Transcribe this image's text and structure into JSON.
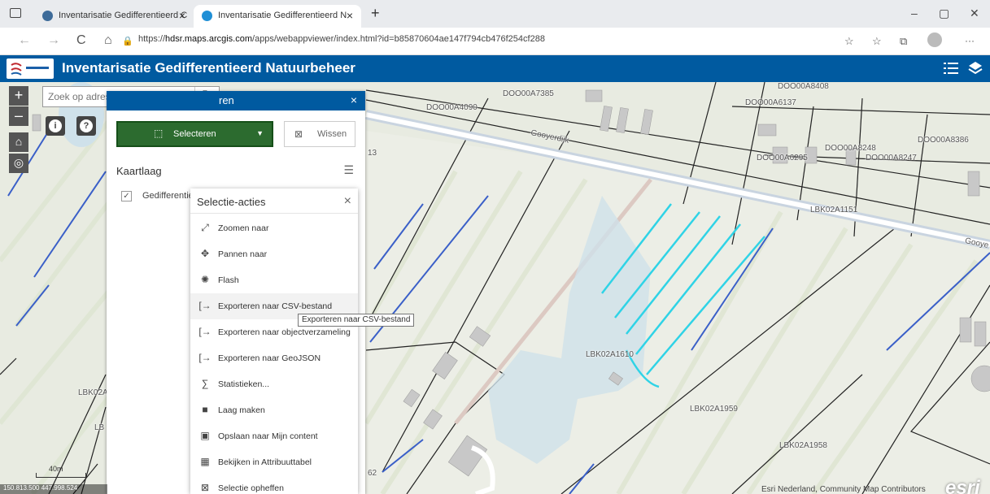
{
  "browser": {
    "tabs": [
      {
        "title": "Inventarisatie Gedifferentieerd C"
      },
      {
        "title": "Inventarisatie Gedifferentieerd N"
      }
    ],
    "new_tab": "+",
    "url_prefix": "https://",
    "url_host": "hdsr.maps.arcgis.com",
    "url_path": "/apps/webappviewer/index.html?id=b85870604ae147f794cb476f254cf288",
    "controls": {
      "back": "←",
      "forward": "→",
      "refresh": "C",
      "home": "⌂",
      "minimize": "–",
      "maximize": "▢",
      "close": "✕",
      "more": "···"
    }
  },
  "app": {
    "title": "Inventarisatie Gedifferentieerd Natuurbeheer",
    "accent_color": "#005aa0"
  },
  "map_controls": {
    "zoom_in": "+",
    "zoom_out": "–",
    "search_placeholder": "Zoek op adres",
    "info": "i",
    "help": "?"
  },
  "select_panel": {
    "title": "ren",
    "close": "×",
    "select_button": "Selecteren",
    "clear_button": "Wissen",
    "layer_header": "Kaartlaag",
    "layer_name": "Gedifferentieerd",
    "layer_checked": true
  },
  "actions": {
    "title": "Selectie-acties",
    "close": "×",
    "items": [
      {
        "label": "Zoomen naar",
        "icon": "zoom-to-icon",
        "glyph": "⤢"
      },
      {
        "label": "Pannen naar",
        "icon": "pan-to-icon",
        "glyph": "✥"
      },
      {
        "label": "Flash",
        "icon": "flash-icon",
        "glyph": "✺"
      },
      {
        "label": "Exporteren naar CSV-bestand",
        "icon": "export-icon",
        "glyph": "[→"
      },
      {
        "label": "Exporteren naar objectverzameling",
        "icon": "export-icon",
        "glyph": "[→"
      },
      {
        "label": "Exporteren naar GeoJSON",
        "icon": "export-icon",
        "glyph": "[→"
      },
      {
        "label": "Statistieken...",
        "icon": "sigma-icon",
        "glyph": "∑"
      },
      {
        "label": "Laag maken",
        "icon": "layer-create-icon",
        "glyph": "■"
      },
      {
        "label": "Opslaan naar Mijn content",
        "icon": "save-icon",
        "glyph": "▣"
      },
      {
        "label": "Bekijken in Attribuuttabel",
        "icon": "table-icon",
        "glyph": "▦"
      },
      {
        "label": "Selectie opheffen",
        "icon": "clear-selection-icon",
        "glyph": "⊠"
      }
    ],
    "hovered_index": 3
  },
  "tooltip": "Exporteren naar CSV-bestand",
  "map_labels": {
    "parcels": [
      "DOO00A4090",
      "DOO00A7385",
      "DOO00A8408",
      "DOO00A6137",
      "DOO00A6295",
      "DOO00A8248",
      "DOO00A8247",
      "DOO00A8386",
      "LBK02A1151",
      "LBK02A1610",
      "LBK02A1959",
      "LBK02A1958",
      "LBK02A",
      "LB"
    ],
    "roads": [
      "Gooyerdijk",
      "Gooye"
    ],
    "numbers": [
      "13",
      "62"
    ]
  },
  "scale": "40m",
  "coordinates": "150.813.500 447.998.524",
  "attribution": "Esri Nederland, Community Map Contributors",
  "esri_logo": "esri"
}
